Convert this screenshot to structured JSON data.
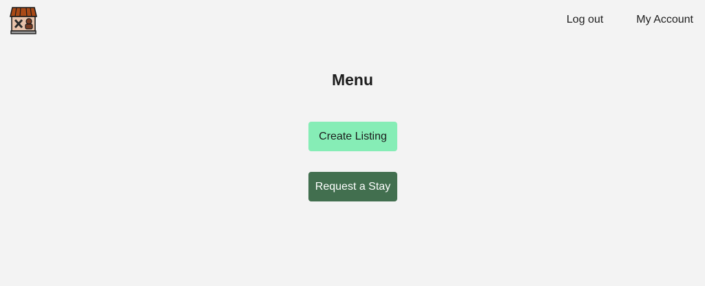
{
  "header": {
    "logo_icon": "storefront-icon",
    "nav": {
      "logout_label": "Log out",
      "account_label": "My Account"
    }
  },
  "main": {
    "title": "Menu",
    "buttons": {
      "create_listing_label": "Create Listing",
      "request_stay_label": "Request a Stay"
    }
  },
  "colors": {
    "background": "#f3f3f3",
    "create_button": "#86edb6",
    "request_button": "#426f4f",
    "request_button_text": "#ffffff"
  }
}
